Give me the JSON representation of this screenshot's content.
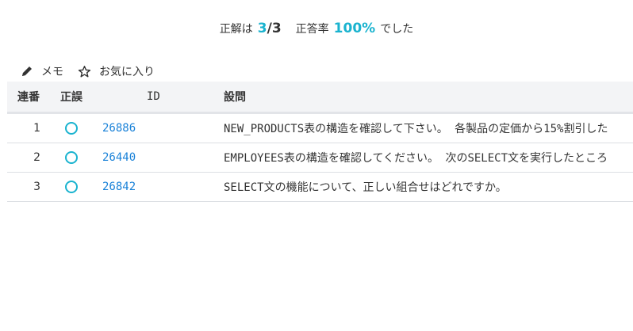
{
  "summary": {
    "prefix": "正解は",
    "correct": "3",
    "total": "/3",
    "rate_label": "正答率",
    "rate": "100%",
    "suffix": "でした"
  },
  "actions": {
    "memo": "メモ",
    "favorite": "お気に入り"
  },
  "table": {
    "headers": {
      "no": "連番",
      "result": "正誤",
      "id": "ID",
      "question": "設問"
    },
    "rows": [
      {
        "no": "1",
        "result": "○",
        "id": "26886",
        "question": "NEW_PRODUCTS表の構造を確認して下さい。 各製品の定価から15%割引した"
      },
      {
        "no": "2",
        "result": "○",
        "id": "26440",
        "question": "EMPLOYEES表の構造を確認してください。 次のSELECT文を実行したところ"
      },
      {
        "no": "3",
        "result": "○",
        "id": "26842",
        "question": "SELECT文の機能について、正しい組合せはどれですか。"
      }
    ]
  },
  "colors": {
    "accent": "#1ab3cf",
    "link": "#1a82d8"
  }
}
